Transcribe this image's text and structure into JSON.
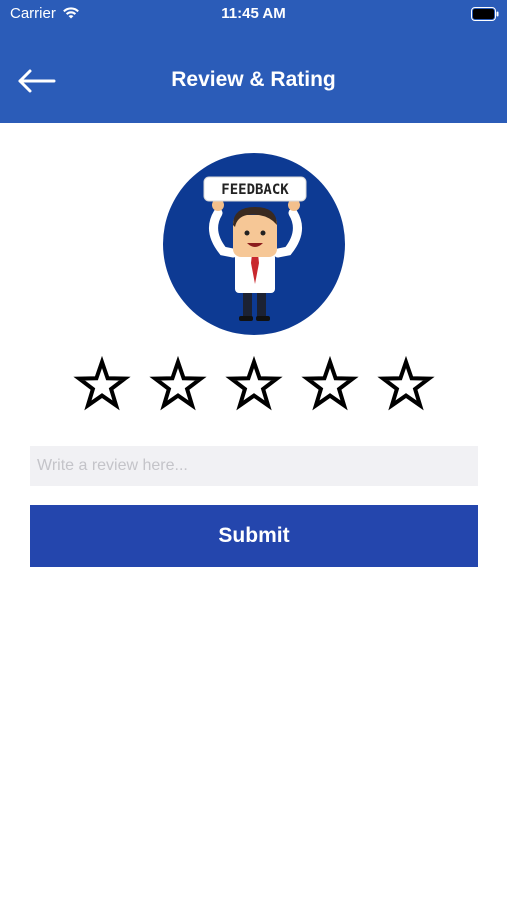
{
  "status_bar": {
    "carrier": "Carrier",
    "time": "11:45 AM",
    "icons": [
      "wifi-icon",
      "battery-icon"
    ]
  },
  "nav": {
    "back_icon": "arrow-left-icon",
    "title": "Review & Rating"
  },
  "illustration": {
    "sign_text": "FEEDBACK",
    "background_color": "#0d3a93"
  },
  "rating": {
    "max": 5,
    "value": 0
  },
  "review": {
    "value": "",
    "placeholder": "Write a review here..."
  },
  "submit": {
    "label": "Submit"
  },
  "colors": {
    "header": "#2b5cb8",
    "button": "#2446ad",
    "input_background": "#f1f1f4"
  }
}
